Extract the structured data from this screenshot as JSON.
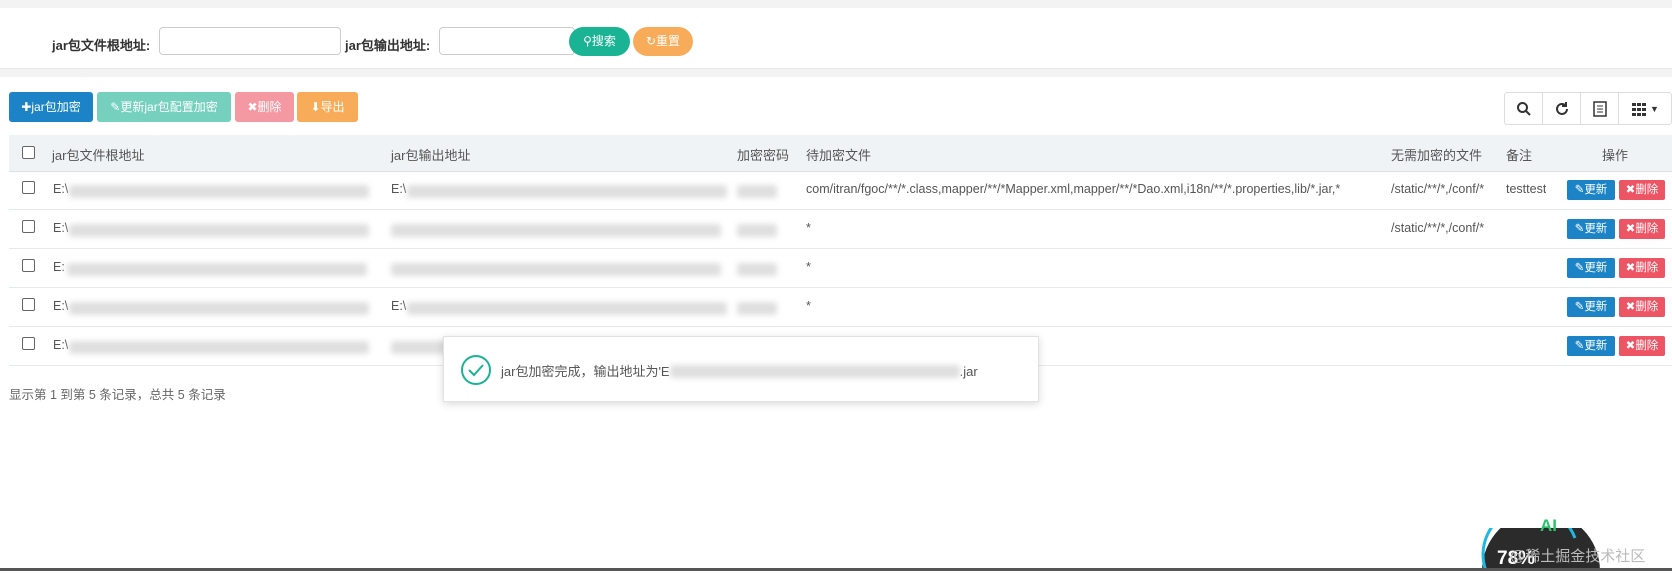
{
  "search": {
    "root_label": "jar包文件根地址:",
    "output_label": "jar包输出地址:",
    "root_value": "",
    "output_value": "",
    "search_button": "搜索",
    "reset_button": "重置"
  },
  "toolbar": {
    "add": "jar包加密",
    "update": "更新jar包配置加密",
    "delete": "删除",
    "export": "导出"
  },
  "table": {
    "headers": [
      "jar包文件根地址",
      "jar包输出地址",
      "加密密码",
      "待加密文件",
      "无需加密的文件",
      "备注",
      "操作"
    ],
    "rows": [
      {
        "root": "E:\\",
        "output": "E:\\",
        "files": "com/itran/fgoc/**/*.class,mapper/**/*Mapper.xml,mapper/**/*Dao.xml,i18n/**/*.properties,lib/*.jar,*",
        "exclude": "/static/**/*,/conf/*",
        "note": "testtest"
      },
      {
        "root": "E:\\",
        "output": "",
        "files": "*",
        "exclude": "/static/**/*,/conf/*",
        "note": ""
      },
      {
        "root": "E:",
        "output": "",
        "files": "*",
        "exclude": "",
        "note": ""
      },
      {
        "root": "E:\\",
        "output": "E:\\",
        "files": "*",
        "exclude": "",
        "note": ""
      },
      {
        "root": "E:\\",
        "output": "",
        "files": "",
        "exclude": "",
        "note": ""
      }
    ],
    "row_update": "更新",
    "row_delete": "删除"
  },
  "summary": "显示第 1 到第 5 条记录，总共 5 条记录",
  "toast": {
    "text_prefix": "jar包加密完成，输出地址为'E",
    "text_suffix": ".jar"
  },
  "widget": {
    "percent": "78%",
    "ai": "AI",
    "watermark": "@稀土掘金技术社区"
  },
  "colors": {
    "primary": "#1c84c6",
    "success": "#1ab394",
    "warning": "#f8ac59",
    "danger": "#ed5565"
  }
}
